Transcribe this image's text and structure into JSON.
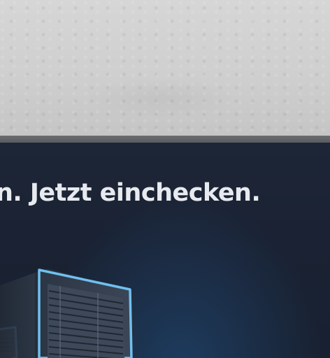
{
  "banner": {
    "headline": "n. Jetzt einchecken."
  },
  "colors": {
    "wall": "#cfcfcf",
    "frame": "#5e6063",
    "screen_background": "#1a2233",
    "headline_text": "#e7eaee",
    "server_glow": "#5fb4ec"
  },
  "icons": {
    "illustration": "server-rack-icon"
  }
}
